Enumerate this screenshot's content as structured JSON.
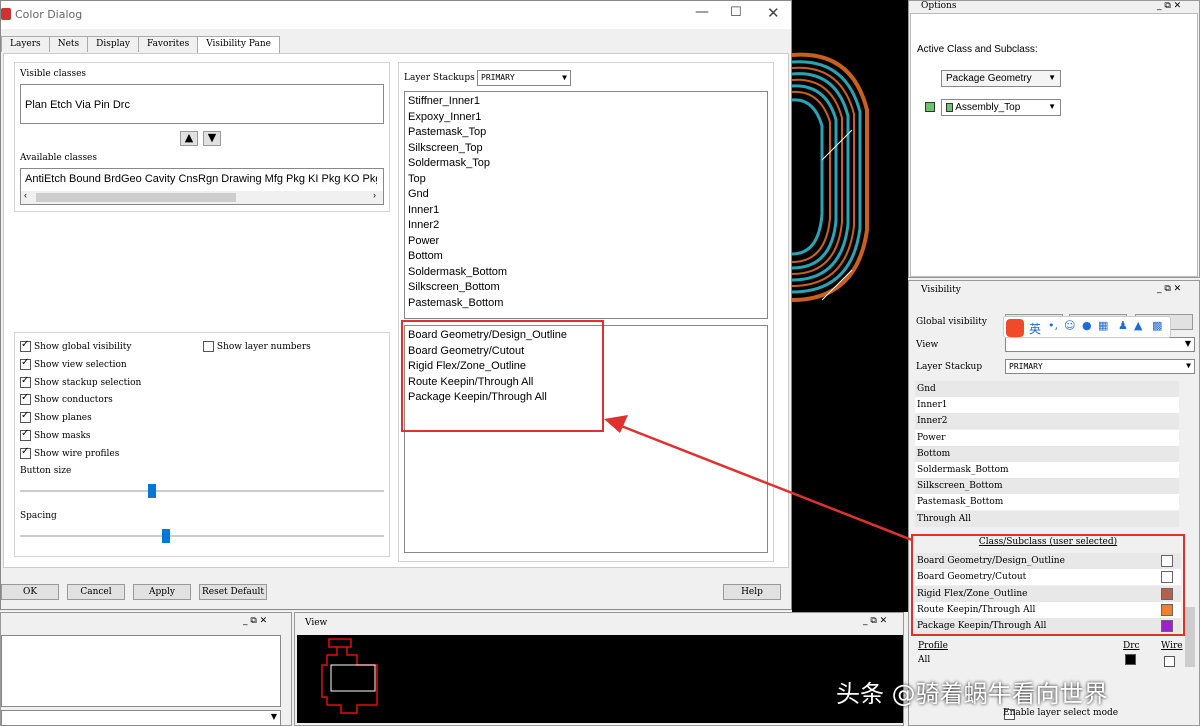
{
  "dialog": {
    "title": "Color Dialog",
    "tabs": [
      "Layers",
      "Nets",
      "Display",
      "Favorites",
      "Visibility Pane"
    ],
    "visible_classes_label": "Visible classes",
    "visible_classes": "Plan  Etch  Via  Pin  Drc",
    "available_classes_label": "Available classes",
    "available_classes": "AntiEtch  Bound  BrdGeo  Cavity  CnsRgn  Drawing  Mfg  Pkg KI  Pkg KO  PkgG",
    "layer_stackups_label": "Layer Stackups",
    "layer_stackup_value": "PRIMARY",
    "layers": [
      "Stiffner_Inner1",
      "Expoxy_Inner1",
      "Pastemask_Top",
      "Silkscreen_Top",
      "Soldermask_Top",
      "Top",
      "Gnd",
      "Inner1",
      "Inner2",
      "Power",
      "Bottom",
      "Soldermask_Bottom",
      "Silkscreen_Bottom",
      "Pastemask_Bottom"
    ],
    "subclasses": [
      "Board Geometry/Design_Outline",
      "Board Geometry/Cutout",
      "Rigid Flex/Zone_Outline",
      "Route Keepin/Through All",
      "Package Keepin/Through All"
    ],
    "options": [
      {
        "label": "Show global visibility",
        "checked": true
      },
      {
        "label": "Show view selection",
        "checked": true
      },
      {
        "label": "Show stackup selection",
        "checked": true
      },
      {
        "label": "Show conductors",
        "checked": true
      },
      {
        "label": "Show planes",
        "checked": true
      },
      {
        "label": "Show masks",
        "checked": true
      },
      {
        "label": "Show wire profiles",
        "checked": true
      }
    ],
    "show_layer_numbers": "Show layer numbers",
    "button_size_label": "Button size",
    "spacing_label": "Spacing",
    "button_size_value": 0.36,
    "spacing_value": 0.4,
    "buttons": {
      "ok": "OK",
      "cancel": "Cancel",
      "apply": "Apply",
      "reset": "Reset Default",
      "help": "Help"
    }
  },
  "view_panel": {
    "title": "View"
  },
  "options_panel": {
    "title": "Options",
    "active_label": "Active Class and Subclass:",
    "class_value": "Package Geometry",
    "subclass_value": "Assembly_Top"
  },
  "visibility_panel": {
    "title": "Visibility",
    "global_visibility_label": "Global visibility",
    "view_label": "View",
    "layer_stackup_label": "Layer Stackup",
    "layer_stackup_value": "PRIMARY",
    "rows": [
      {
        "name": "Gnd"
      },
      {
        "name": "Inner1"
      },
      {
        "name": "Inner2"
      },
      {
        "name": "Power"
      },
      {
        "name": "Bottom"
      },
      {
        "name": "Soldermask_Bottom"
      },
      {
        "name": "Silkscreen_Bottom"
      },
      {
        "name": "Pastemask_Bottom"
      },
      {
        "name": "Through All"
      }
    ],
    "class_header": "Class/Subclass (user selected)",
    "class_rows": [
      {
        "name": "Board Geometry/Design_Outline",
        "color": "#ffffff"
      },
      {
        "name": "Board Geometry/Cutout",
        "color": "#ffffff"
      },
      {
        "name": "Rigid Flex/Zone_Outline",
        "color": "#b5604a"
      },
      {
        "name": "Route Keepin/Through All",
        "color": "#f08030"
      },
      {
        "name": "Package Keepin/Through All",
        "color": "#a020d0"
      }
    ],
    "profile_label": "Profile",
    "drc_label": "Drc",
    "wire_label": "Wire",
    "all_label": "All",
    "enable_layer_select": "Enable layer select mode"
  },
  "ime_toolbar": {
    "lang": "英"
  },
  "watermark": "头条 @骑着蜗牛看向世界"
}
